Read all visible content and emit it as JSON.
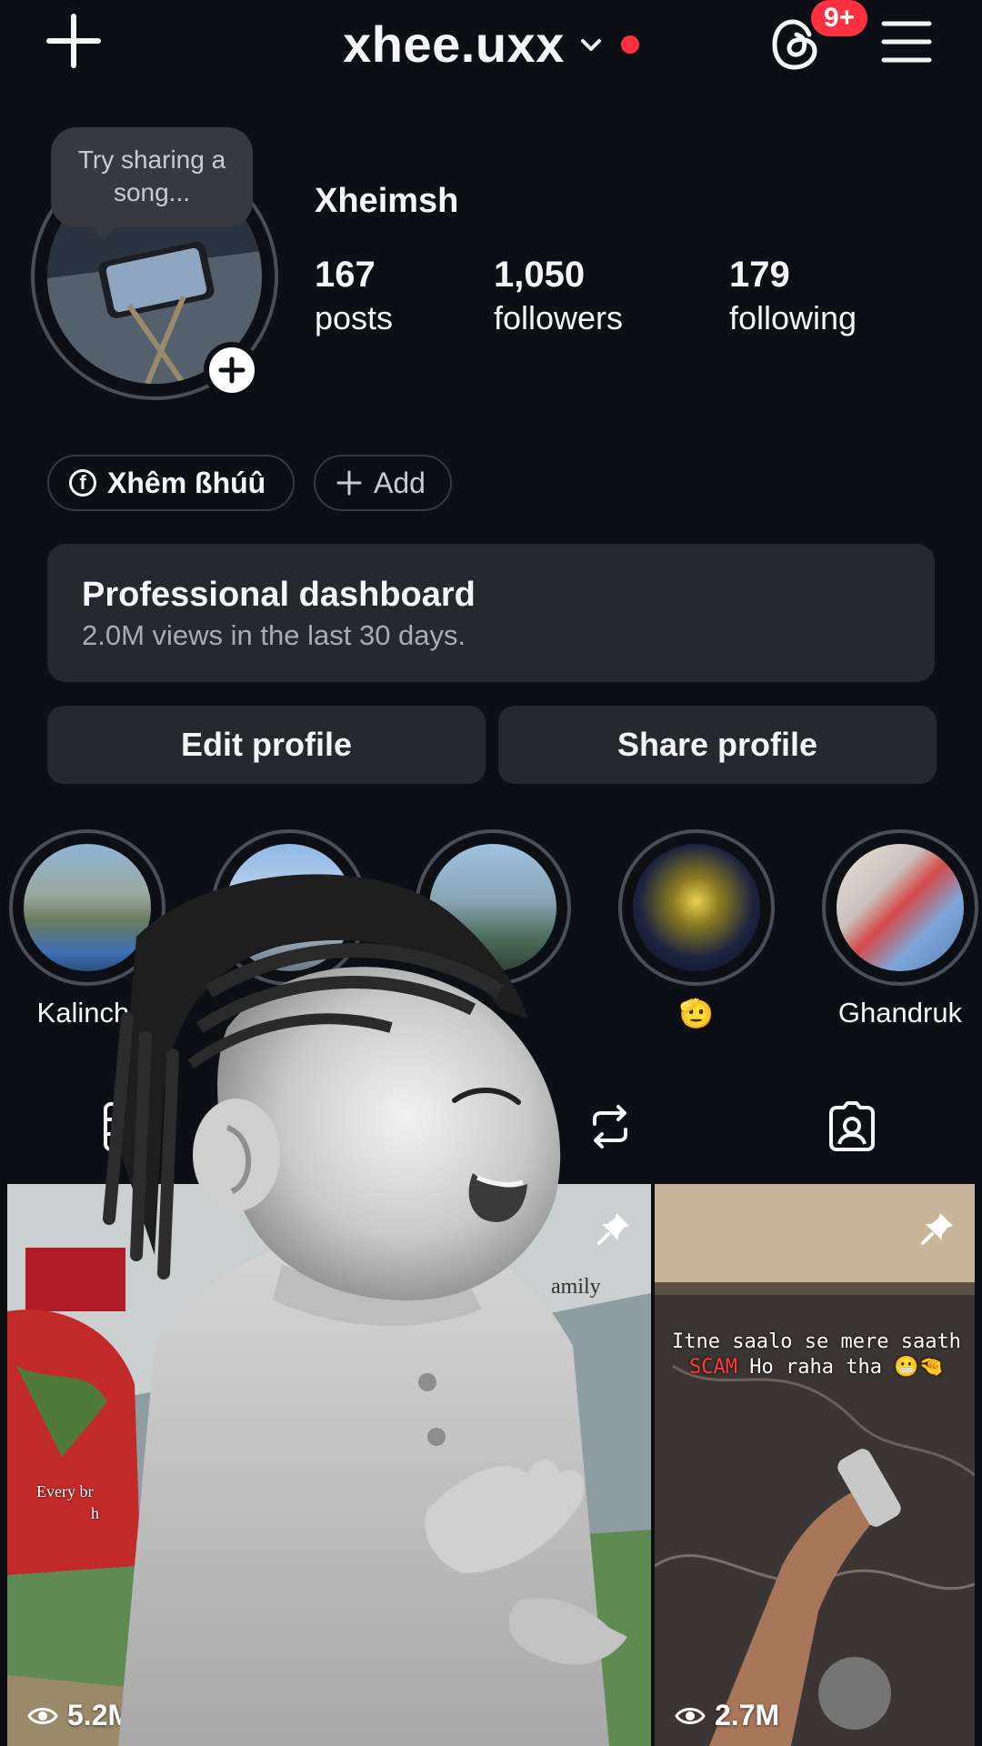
{
  "header": {
    "username": "xhee.uxx",
    "notification_badge": "9+"
  },
  "profile": {
    "song_prompt": "Try sharing a song...",
    "display_name": "Xheimsh",
    "stats": [
      {
        "value": "167",
        "label": "posts"
      },
      {
        "value": "1,050",
        "label": "followers"
      },
      {
        "value": "179",
        "label": "following"
      }
    ]
  },
  "links": {
    "facebook_label": "Xhêm ßhúû",
    "add_label": "Add"
  },
  "dashboard": {
    "title": "Professional dashboard",
    "subtitle": "2.0M views in the last 30 days."
  },
  "buttons": {
    "edit": "Edit profile",
    "share": "Share profile"
  },
  "highlights": [
    {
      "label": "Kalincho"
    },
    {
      "label": ""
    },
    {
      "label": ""
    },
    {
      "label": "🫡"
    },
    {
      "label": "Ghandruk"
    }
  ],
  "posts": [
    {
      "views": "5.2M",
      "caption_fragment_1": "Every br",
      "caption_fragment_2": "h",
      "caption_fragment_3": "amily"
    },
    {
      "views": "2.7M",
      "caption_part_1": "Itne saalo se mere saath ",
      "caption_scam": "SCAM",
      "caption_part_2": " Ho raha tha 😬🤏"
    }
  ],
  "colors": {
    "background": "#0c1014",
    "surface": "#25292e",
    "badge_red": "#ff3040",
    "muted_text": "#a8adb4"
  }
}
